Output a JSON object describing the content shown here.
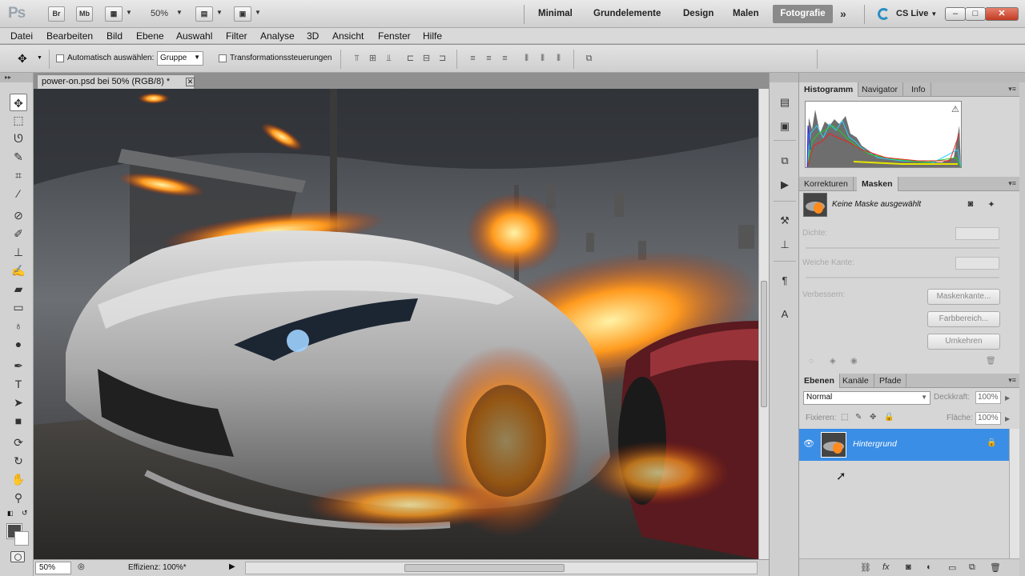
{
  "appbar": {
    "logo": "Ps",
    "bridge_label": "Br",
    "minibridge_label": "Mb",
    "zoom": "50%",
    "workspaces": [
      "Minimal",
      "Grundelemente",
      "Design",
      "Malen"
    ],
    "active_workspace": "Fotografie",
    "more_label": "»",
    "cslive": "CS Live",
    "minimize_label": "–",
    "maximize_label": "□",
    "close_label": "✕"
  },
  "menu": [
    "Datei",
    "Bearbeiten",
    "Bild",
    "Ebene",
    "Auswahl",
    "Filter",
    "Analyse",
    "3D",
    "Ansicht",
    "Fenster",
    "Hilfe"
  ],
  "options": {
    "auto_select_label": "Automatisch auswählen:",
    "auto_select_value": "Gruppe",
    "transform_label": "Transformationssteuerungen"
  },
  "document": {
    "tab_title": "power-on.psd bei 50% (RGB/8) *",
    "zoom_field": "50%",
    "status": "Effizienz: 100%*"
  },
  "panels": {
    "tabs_top": [
      "Histogramm",
      "Navigator",
      "Info"
    ],
    "tabs_mid": [
      "Korrekturen",
      "Masken"
    ],
    "tabs_bottom": [
      "Ebenen",
      "Kanäle",
      "Pfade"
    ],
    "no_mask": "Keine Maske ausgewählt",
    "density_label": "Dichte:",
    "feather_label": "Weiche Kante:",
    "refine_label": "Verbessern:",
    "btn_mask_edge": "Maskenkante...",
    "btn_color_range": "Farbbereich...",
    "btn_invert": "Umkehren",
    "blend_mode": "Normal",
    "opacity_label": "Deckkraft:",
    "opacity_value": "100%",
    "lock_label": "Fixieren:",
    "fill_label": "Fläche:",
    "fill_value": "100%",
    "layer_name": "Hintergrund"
  },
  "colors": {
    "selected_layer": "#3a8ee6",
    "active_workspace_bg": "#8a8a8a",
    "close_button": "#c23b22"
  }
}
